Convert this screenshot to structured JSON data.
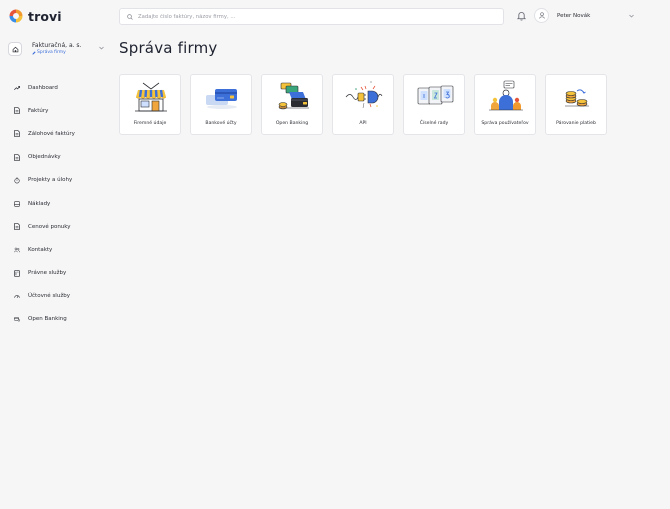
{
  "app": {
    "logo_text": "trovi"
  },
  "company": {
    "name": "Fakturačná, a. s.",
    "subtitle": "Správa firmy"
  },
  "search": {
    "placeholder": "Zadajte číslo faktúry, názov firmy, ..."
  },
  "user": {
    "name": "Peter Novák"
  },
  "sidebar": {
    "items": [
      {
        "label": "Dashboard",
        "icon": "trend-up-icon"
      },
      {
        "label": "Faktúry",
        "icon": "document-icon"
      },
      {
        "label": "Zálohové faktúry",
        "icon": "document-icon"
      },
      {
        "label": "Objednávky",
        "icon": "document-icon"
      },
      {
        "label": "Projekty a úlohy",
        "icon": "timer-icon"
      },
      {
        "label": "Náklady",
        "icon": "wallet-icon"
      },
      {
        "label": "Cenové ponuky",
        "icon": "document-icon"
      },
      {
        "label": "Kontakty",
        "icon": "contacts-icon"
      },
      {
        "label": "Právne služby",
        "icon": "legal-icon"
      },
      {
        "label": "Účtovné služby",
        "icon": "accounting-icon"
      },
      {
        "label": "Open Banking",
        "icon": "bank-icon"
      }
    ]
  },
  "page": {
    "title": "Správa firmy"
  },
  "cards": [
    {
      "label": "Firemné údaje",
      "icon": "storefront-illustration"
    },
    {
      "label": "Bankové účty",
      "icon": "bank-card-illustration"
    },
    {
      "label": "Open Banking",
      "icon": "wallet-coins-illustration"
    },
    {
      "label": "API",
      "icon": "plug-connector-illustration"
    },
    {
      "label": "Číselné rady",
      "icon": "cards-stack-illustration"
    },
    {
      "label": "Správa používateľov",
      "icon": "users-illustration"
    },
    {
      "label": "Párovanie platieb",
      "icon": "coins-stack-illustration"
    }
  ],
  "colors": {
    "accent": "#3d6fd9",
    "logo_orange": "#f29a2e",
    "logo_blue": "#3a8de6",
    "background": "#f6f6f7"
  }
}
